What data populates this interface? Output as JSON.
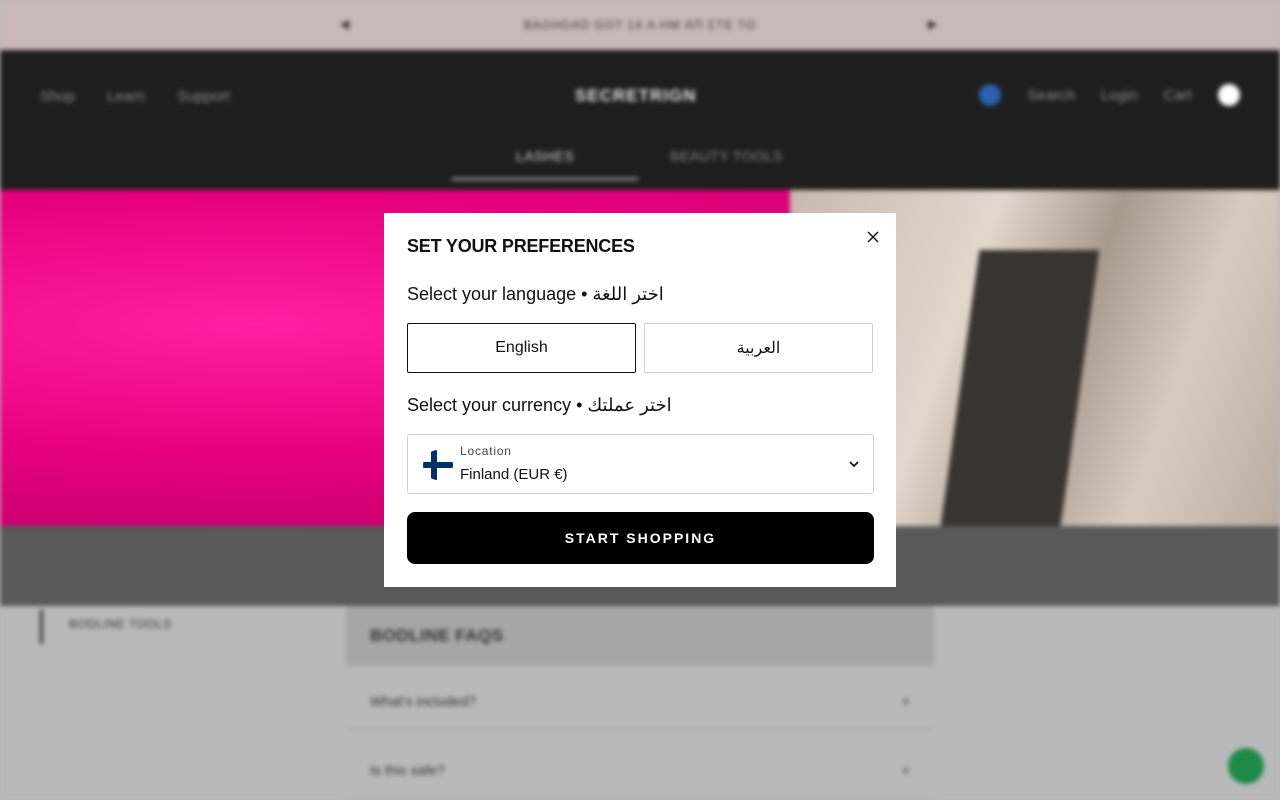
{
  "background": {
    "announcement": "BAGHDAD GOT 14 Α HM ΑΠ ΣΤΕ ΤΟ",
    "nav_left": [
      "Shop",
      "Learn",
      "Support"
    ],
    "logo": "SECRETRIGN",
    "nav_right": [
      "Search",
      "Login",
      "Cart"
    ],
    "tabs": [
      "LASHES",
      "BEAUTY TOOLS"
    ],
    "side_item": "BODLINE TOOLS",
    "faq_title": "BODLINE FAQS",
    "faq_rows": [
      "What's included?",
      "Is this safe?"
    ]
  },
  "modal": {
    "title": "SET YOUR PREFERENCES",
    "language_label": "Select your language • اختر اللغة",
    "languages": [
      {
        "label": "English",
        "selected": true
      },
      {
        "label": "العربية",
        "selected": false
      }
    ],
    "currency_label": "Select your currency • اختر عملتك",
    "location": {
      "label": "Location",
      "value": "Finland (EUR €)",
      "flag_icon": "finland-flag-icon"
    },
    "cta_label": "START SHOPPING"
  },
  "colors": {
    "accent": "#000000",
    "flag_blue": "#002f6c"
  }
}
